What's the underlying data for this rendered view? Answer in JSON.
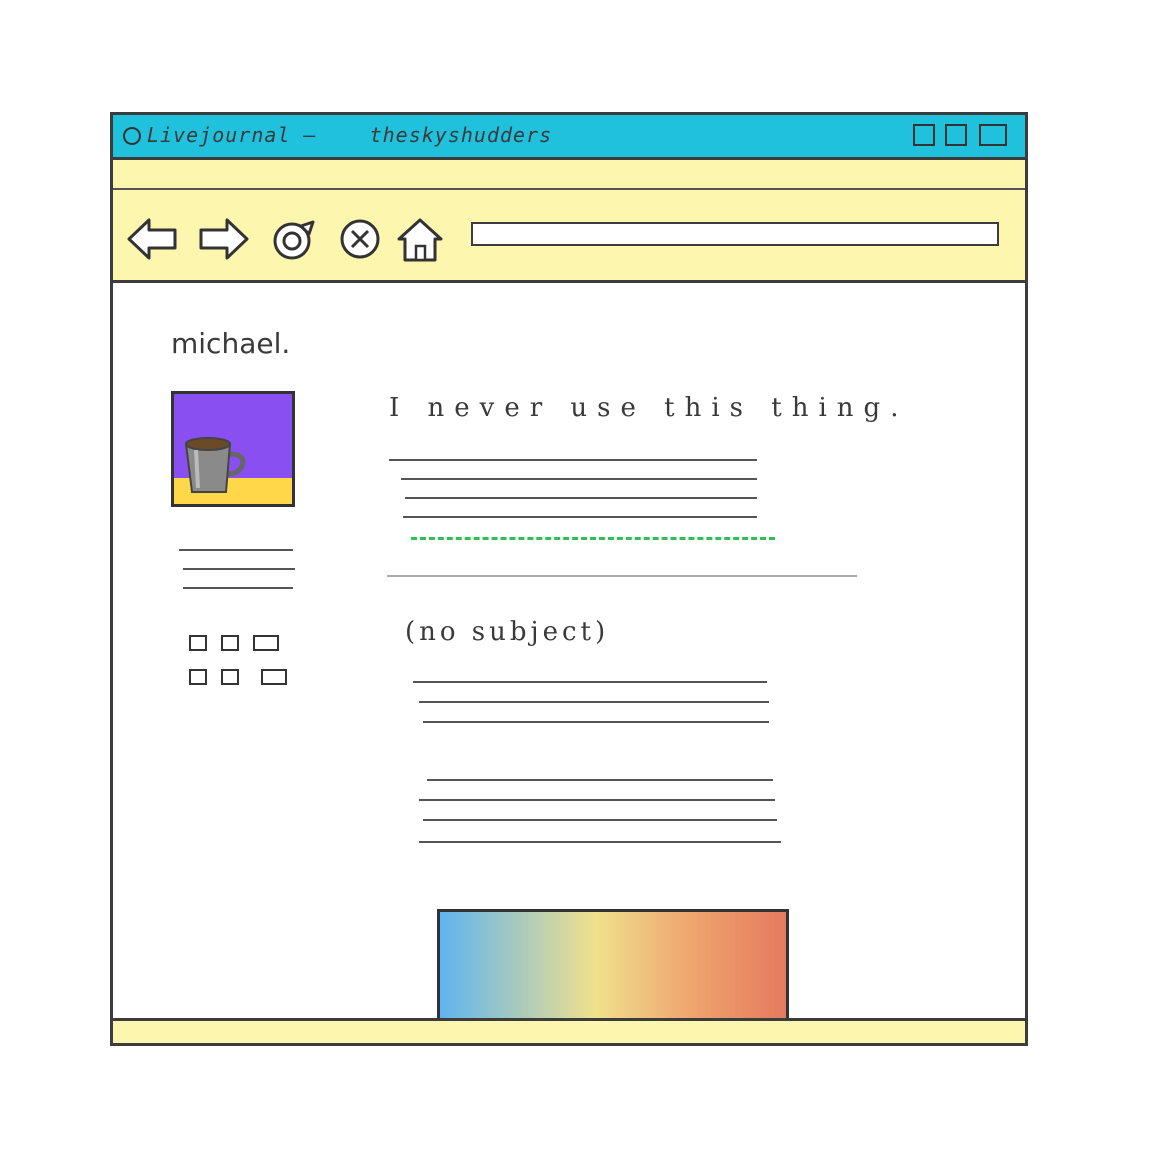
{
  "window": {
    "title_app": "Livejournal",
    "title_separator": "–",
    "title_user": "theskyshudders",
    "colors": {
      "titlebar": "#1fc1dc",
      "toolbar": "#fdf6ae",
      "frame": "#3c3c3c"
    }
  },
  "toolbar": {
    "buttons": [
      {
        "name": "back",
        "icon": "arrow-left-icon"
      },
      {
        "name": "forward",
        "icon": "arrow-right-icon"
      },
      {
        "name": "reload",
        "icon": "reload-icon"
      },
      {
        "name": "stop",
        "icon": "close-circle-icon"
      },
      {
        "name": "home",
        "icon": "home-icon"
      }
    ],
    "url_value": ""
  },
  "profile": {
    "username": "michael.",
    "userpic_colors": {
      "top": "#8a4ff0",
      "bottom": "#ffd84a",
      "mug": "#777777"
    }
  },
  "posts": [
    {
      "title": "I never use this thing."
    },
    {
      "title": "(no subject)"
    }
  ],
  "colors": {
    "link_underline": "#2fbf5a",
    "banner_gradient": [
      "#5fb4ee",
      "#f0e08c",
      "#eea06c",
      "#e47a5e"
    ]
  }
}
